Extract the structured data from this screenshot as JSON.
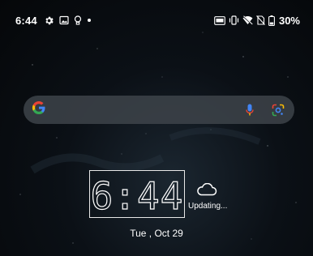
{
  "status_bar": {
    "time": "6:44",
    "battery": "30%",
    "left_icons": [
      "gear-icon",
      "image-icon",
      "bulb-icon",
      "dot-icon"
    ],
    "right_icons": [
      "nfc-icon",
      "vibrate-icon",
      "wifi-off-icon",
      "sim-off-icon",
      "battery-icon"
    ]
  },
  "search_bar": {
    "logo": "G",
    "icons": [
      "mic-icon",
      "lens-icon"
    ],
    "colors": {
      "blue": "#4285F4",
      "red": "#EA4335",
      "yellow": "#FBBC05",
      "green": "#34A853"
    }
  },
  "clock_widget": {
    "time": "6:44"
  },
  "weather": {
    "status": "Updating..."
  },
  "date": "Tue , Oct 29"
}
